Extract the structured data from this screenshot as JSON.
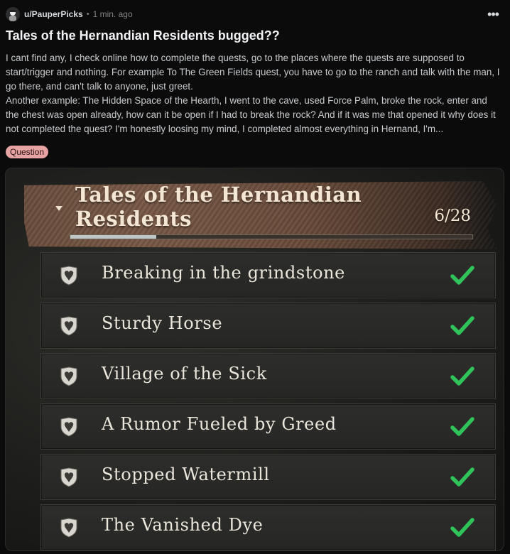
{
  "post": {
    "username": "u/PauperPicks",
    "separator": "•",
    "time": "1 min. ago",
    "more_label": "•••",
    "title": "Tales of the Hernandian Residents bugged??",
    "body_p1": "I cant find any, I check online how to complete the quests, go to the places where the quests are supposed to start/trigger and nothing. For example To The Green Fields quest, you have to go to the ranch and talk with the man, I go there, and can't talk to anyone, just greet.",
    "body_p2": "Another example: The Hidden Space of the Hearth, I went to the cave, used Force Palm, broke the rock, enter and the chest was open already, how can it be open if I had to break the rock? And if it was me that opened it why does it not completed the quest? I'm honestly loosing my mind, I completed almost everything in Hernand, I'm...",
    "flair": "Question"
  },
  "screenshot": {
    "banner_title": "Tales of the Hernandian Residents",
    "count_current": "6",
    "count_separator": "/",
    "count_total": "28",
    "progress_fraction": 0.214,
    "quests": [
      {
        "name": "Breaking in the grindstone",
        "icon": "quest-crest-icon",
        "completed": true
      },
      {
        "name": "Sturdy Horse",
        "icon": "quest-crest-icon",
        "completed": true
      },
      {
        "name": "Village of the Sick",
        "icon": "quest-crest-icon",
        "completed": true
      },
      {
        "name": "A Rumor Fueled by Greed",
        "icon": "quest-crest-icon",
        "completed": true
      },
      {
        "name": "Stopped Watermill",
        "icon": "quest-crest-icon",
        "completed": true
      },
      {
        "name": "The Vanished Dye",
        "icon": "quest-crest-icon",
        "completed": true
      }
    ]
  },
  "colors": {
    "flair_bg": "#e8a4a4",
    "check": "#2fc35a",
    "background": "#0b0b0c"
  }
}
